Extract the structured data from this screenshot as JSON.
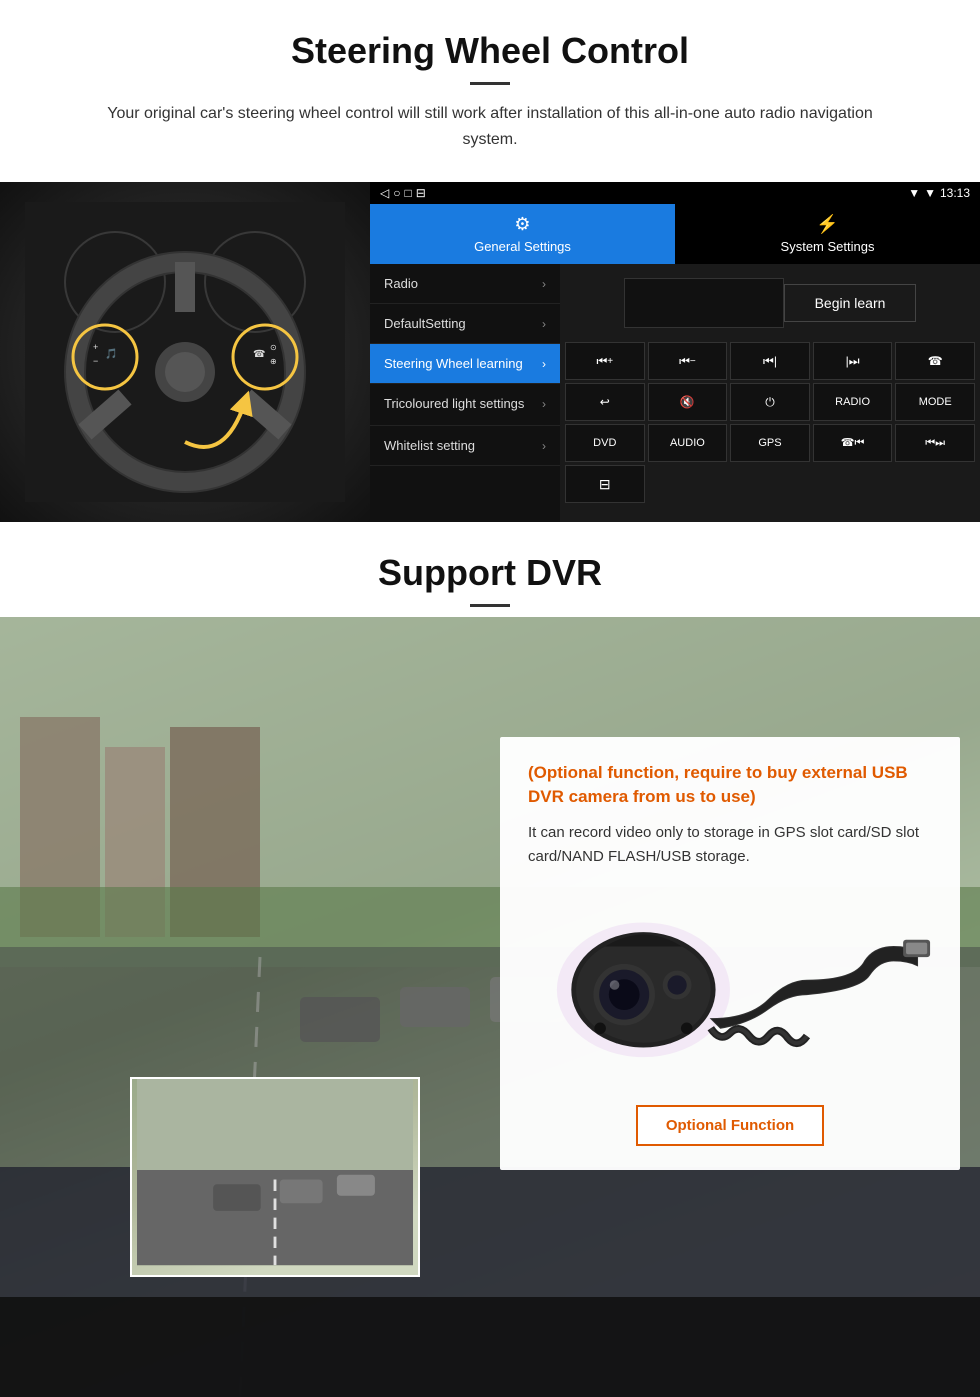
{
  "page": {
    "section1": {
      "title": "Steering Wheel Control",
      "description": "Your original car's steering wheel control will still work after installation of this all-in-one auto radio navigation system.",
      "divider": "—",
      "statusbar": {
        "time": "13:13",
        "signal": "▼",
        "wifi": "▼"
      },
      "tabs": [
        {
          "label": "General Settings",
          "icon": "⚙",
          "active": true
        },
        {
          "label": "System Settings",
          "icon": "⚡",
          "active": false
        }
      ],
      "menu": [
        {
          "label": "Radio",
          "active": false
        },
        {
          "label": "DefaultSetting",
          "active": false
        },
        {
          "label": "Steering Wheel learning",
          "active": true
        },
        {
          "label": "Tricoloured light settings",
          "active": false
        },
        {
          "label": "Whitelist setting",
          "active": false
        }
      ],
      "beginLearn": "Begin learn",
      "controls": [
        "⏮+",
        "⏮−",
        "⏮|",
        "⏭|",
        "☎",
        "↩",
        "🔇",
        "⏻",
        "RADIO",
        "MODE",
        "DVD",
        "AUDIO",
        "GPS",
        "☎|⏮",
        "⏮⏭"
      ]
    },
    "section2": {
      "title": "Support DVR",
      "divider": "—",
      "optionalTitle": "(Optional function, require to buy external USB DVR camera from us to use)",
      "description": "It can record video only to storage in GPS slot card/SD slot card/NAND FLASH/USB storage.",
      "optionalButton": "Optional Function"
    }
  }
}
